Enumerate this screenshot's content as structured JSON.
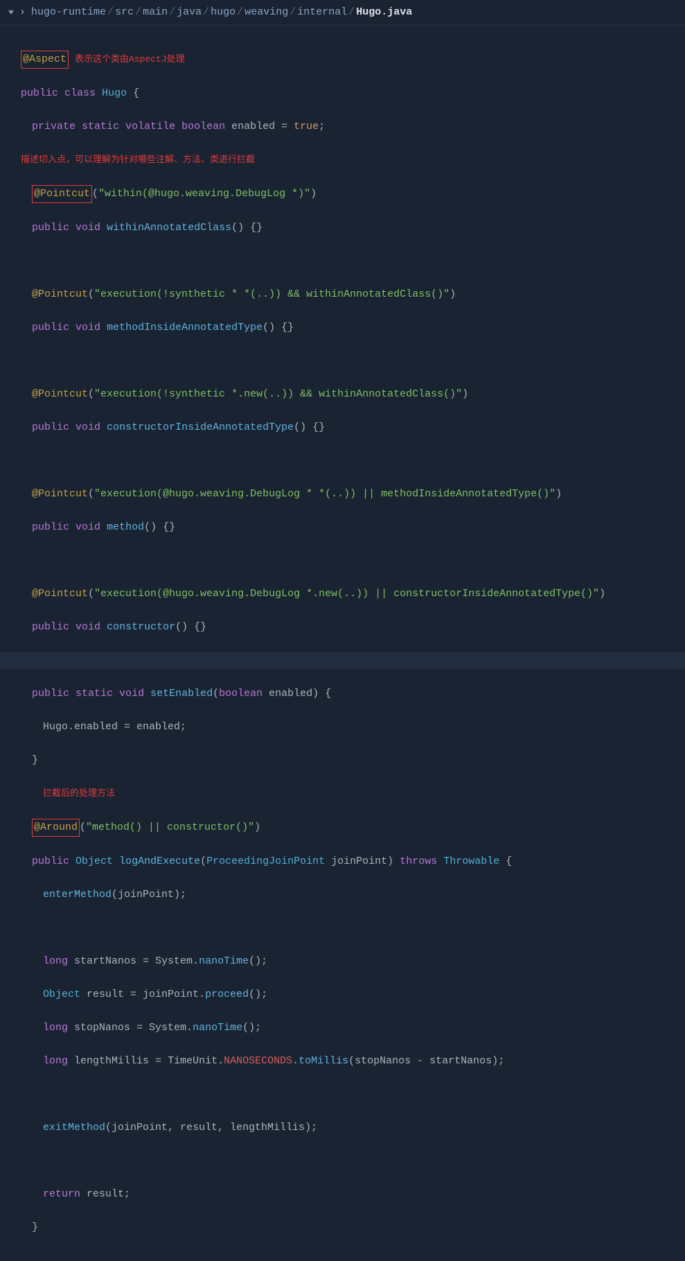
{
  "breadcrumb": {
    "items": [
      "hugo-runtime",
      "src",
      "main",
      "java",
      "hugo",
      "weaving",
      "internal"
    ],
    "current": "Hugo.java",
    "sep": "/"
  },
  "annotations": {
    "aspect_note": "表示这个类由AspectJ处理",
    "pointcut_note": "描述切入点，可以理解为针对哪些注解、方法、类进行拦截",
    "around_note": "拦截后的处理方法"
  },
  "code": {
    "at_aspect": "@Aspect",
    "public": "public",
    "class": "class",
    "hugo": "Hugo",
    "private": "private",
    "static": "static",
    "volatile": "volatile",
    "boolean": "boolean",
    "enabled": "enabled",
    "true": "true",
    "void": "void",
    "at_pointcut": "@Pointcut",
    "at_around": "@Around",
    "object": "Object",
    "long": "long",
    "throws": "throws",
    "throwable": "Throwable",
    "return": "return",
    "eq": " = ",
    "semi": ";",
    "lbrace": " {",
    "rbrace": "}",
    "lparen": "(",
    "rparen": ")",
    "empty_body": "() {}",
    "str_within": "\"within(@hugo.weaving.DebugLog *)\"",
    "m_withinAnnotatedClass": "withinAnnotatedClass",
    "str_exec_method": "\"execution(!synthetic * *(..)) && withinAnnotatedClass()\"",
    "m_methodInsideAnnotatedType": "methodInsideAnnotatedType",
    "str_exec_ctor": "\"execution(!synthetic *.new(..)) && withinAnnotatedClass()\"",
    "m_constructorInsideAnnotatedType": "constructorInsideAnnotatedType",
    "str_method_pc": "\"execution(@hugo.weaving.DebugLog * *(..)) || methodInsideAnnotatedType()\"",
    "m_method": "method",
    "str_ctor_pc": "\"execution(@hugo.weaving.DebugLog *.new(..)) || constructorInsideAnnotatedType()\"",
    "m_constructor": "constructor",
    "m_setEnabled": "setEnabled",
    "hugo_enabled": "Hugo.enabled = enabled;",
    "str_around": "\"method() || constructor()\"",
    "m_logAndExecute": "logAndExecute",
    "pjp_type": "ProceedingJoinPoint",
    "joinPoint": "joinPoint",
    "m_enterMethod": "enterMethod",
    "jp_arg": "(joinPoint);",
    "startNanos": "startNanos",
    "sys_nano": " = System.",
    "nanoTime": "nanoTime",
    "empty_call": "();",
    "result": "result",
    "jp_proceed": " = joinPoint.",
    "proceed": "proceed",
    "stopNanos": "stopNanos",
    "lengthMillis": "lengthMillis",
    "tu": " = TimeUnit.",
    "nanoseconds": "NANOSECONDS",
    "dot": ".",
    "toMillis": "toMillis",
    "toMillis_args": "(stopNanos - startNanos);",
    "m_exitMethod": "exitMethod",
    "exit_args": "(joinPoint, result, lengthMillis);",
    "result_var": " result;"
  }
}
